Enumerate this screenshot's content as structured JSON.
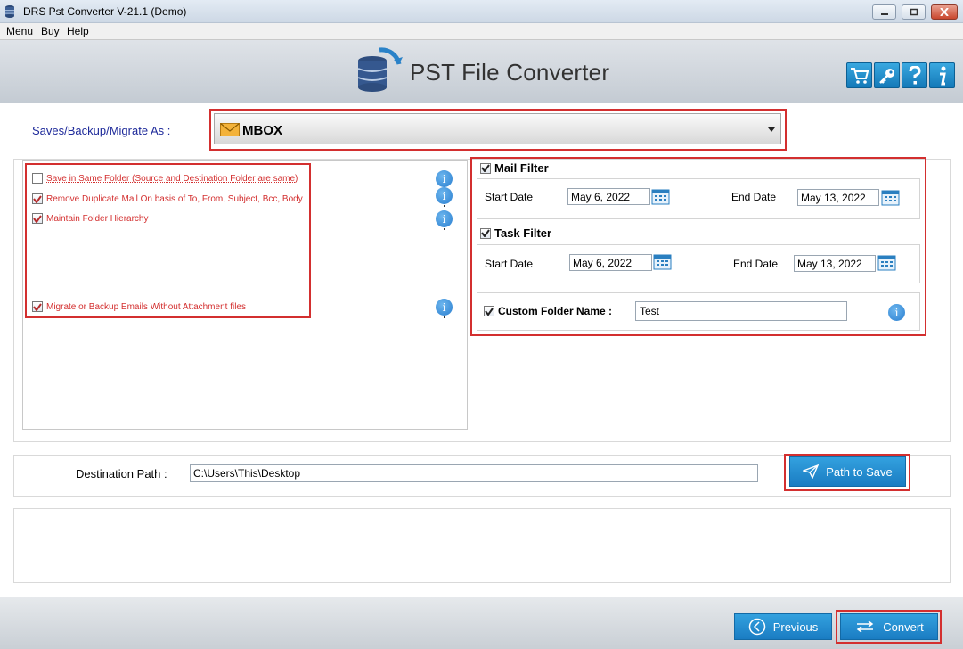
{
  "window": {
    "title": "DRS Pst Converter V-21.1 (Demo)"
  },
  "menu": {
    "items": [
      "Menu",
      "Buy",
      "Help"
    ]
  },
  "header": {
    "brand": "PST File Converter",
    "toolbar_icons": [
      "cart-icon",
      "key-icon",
      "help-icon",
      "info-icon"
    ]
  },
  "format": {
    "label": "Saves/Backup/Migrate As :",
    "selected": "MBOX"
  },
  "options": [
    {
      "label": "Save in Same Folder (Source and Destination Folder are same)",
      "checked": false
    },
    {
      "label": "Remove Duplicate Mail On basis of To, From, Subject, Bcc, Body",
      "checked": true
    },
    {
      "label": "Maintain Folder Hierarchy",
      "checked": true
    },
    {
      "label": "Migrate or Backup Emails Without Attachment files",
      "checked": true
    }
  ],
  "mail_filter": {
    "title": "Mail Filter",
    "checked": true,
    "start_label": "Start Date",
    "start_value": "May 6, 2022",
    "end_label": "End Date",
    "end_value": "May 13, 2022"
  },
  "task_filter": {
    "title": "Task Filter",
    "checked": true,
    "start_label": "Start Date",
    "start_value": "May 6, 2022",
    "end_label": "End Date",
    "end_value": "May 13, 2022"
  },
  "custom_folder": {
    "label": "Custom Folder Name :",
    "checked": true,
    "value": "Test"
  },
  "destination": {
    "label": "Destination Path :",
    "value": "C:\\Users\\This\\Desktop",
    "button": "Path to Save"
  },
  "footer": {
    "previous": "Previous",
    "convert": "Convert"
  },
  "colors": {
    "accent_blue": "#1a7cc2",
    "highlight_red": "#d32f2f",
    "option_text": "#d32f2f",
    "label_blue": "#1e2a9a"
  }
}
